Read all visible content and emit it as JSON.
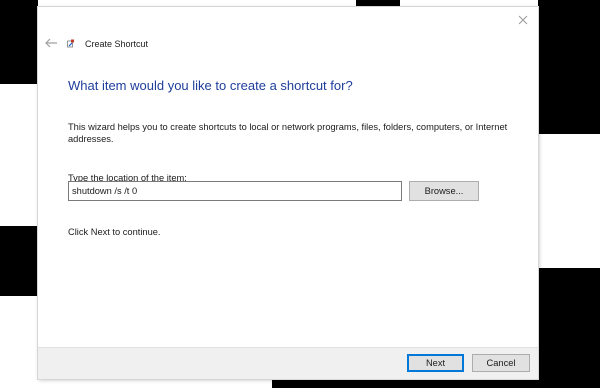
{
  "colors": {
    "heading": "#1e3e9c",
    "footer_bg": "#f0f0f0",
    "default_button_border": "#0078d7"
  },
  "window": {
    "title": "Create Shortcut",
    "back_icon": "back-arrow-icon",
    "close_icon": "close-icon",
    "app_icon": "shortcut-icon"
  },
  "content": {
    "heading": "What item would you like to create a shortcut for?",
    "description": "This wizard helps you to create shortcuts to local or network programs, files, folders, computers, or Internet addresses.",
    "location_label": "Type the location of the item:",
    "location_value": "shutdown /s /t 0",
    "browse_label": "Browse...",
    "hint": "Click Next to continue."
  },
  "footer": {
    "next_label": "Next",
    "cancel_label": "Cancel"
  }
}
